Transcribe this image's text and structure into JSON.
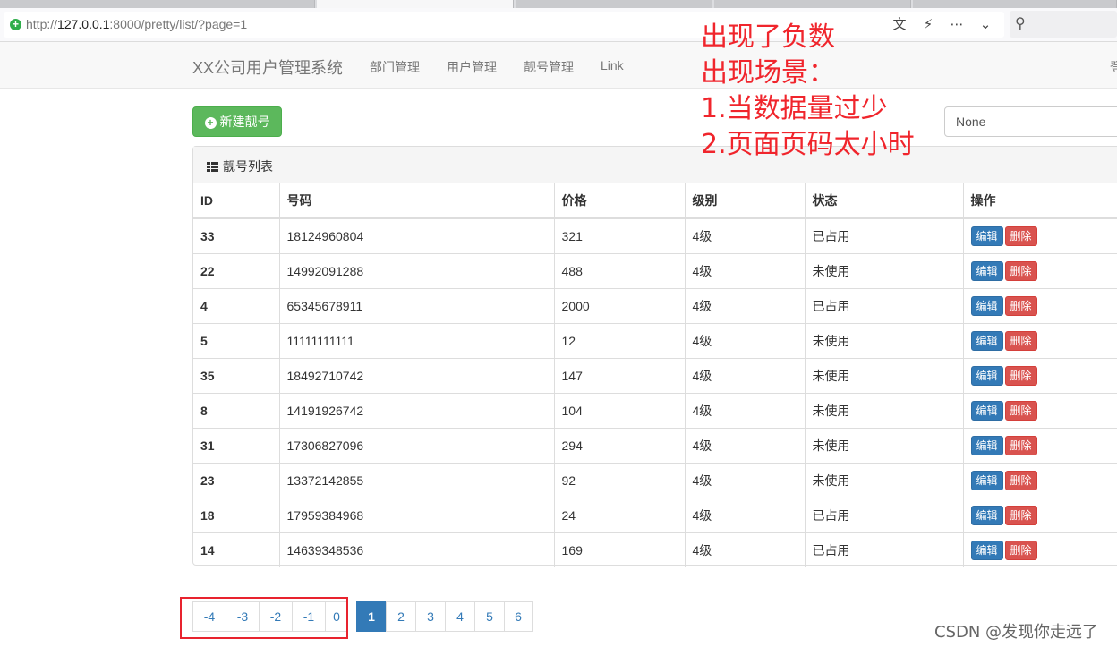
{
  "browser": {
    "url_prefix": "http://",
    "url_host": "127.0.0.1",
    "url_rest": ":8000/pretty/list/?page=1",
    "search_icon": "magnifier-icon"
  },
  "navbar": {
    "brand": "XX公司用户管理系统",
    "links": [
      "部门管理",
      "用户管理",
      "靓号管理",
      "Link"
    ],
    "right_partial": "登"
  },
  "toolbar": {
    "new_button_label": "新建靓号",
    "select_value": "None"
  },
  "panel": {
    "title": "靓号列表"
  },
  "table": {
    "headers": [
      "ID",
      "号码",
      "价格",
      "级别",
      "状态",
      "操作"
    ],
    "rows": [
      {
        "id": "33",
        "mobile": "18124960804",
        "price": "321",
        "level": "4级",
        "status": "已占用"
      },
      {
        "id": "22",
        "mobile": "14992091288",
        "price": "488",
        "level": "4级",
        "status": "未使用"
      },
      {
        "id": "4",
        "mobile": "65345678911",
        "price": "2000",
        "level": "4级",
        "status": "已占用"
      },
      {
        "id": "5",
        "mobile": "11111111111",
        "price": "12",
        "level": "4级",
        "status": "未使用"
      },
      {
        "id": "35",
        "mobile": "18492710742",
        "price": "147",
        "level": "4级",
        "status": "未使用"
      },
      {
        "id": "8",
        "mobile": "14191926742",
        "price": "104",
        "level": "4级",
        "status": "未使用"
      },
      {
        "id": "31",
        "mobile": "17306827096",
        "price": "294",
        "level": "4级",
        "status": "未使用"
      },
      {
        "id": "23",
        "mobile": "13372142855",
        "price": "92",
        "level": "4级",
        "status": "未使用"
      },
      {
        "id": "18",
        "mobile": "17959384968",
        "price": "24",
        "level": "4级",
        "status": "已占用"
      },
      {
        "id": "14",
        "mobile": "14639348536",
        "price": "169",
        "level": "4级",
        "status": "已占用"
      }
    ],
    "edit_label": "编辑",
    "delete_label": "删除"
  },
  "pagination": {
    "pages": [
      "-4",
      "-3",
      "-2",
      "-1",
      "0",
      "1",
      "2",
      "3",
      "4",
      "5",
      "6"
    ],
    "active": "1"
  },
  "annotation": {
    "lines": [
      "出现了负数",
      "出现场景：",
      "1.当数据量过少",
      "2.页面页码太小时"
    ],
    "color": "#f0252c"
  },
  "watermark": "CSDN @发现你走远了",
  "colors": {
    "primary": "#337ab7",
    "success": "#5cb85c",
    "danger": "#d9534f"
  }
}
